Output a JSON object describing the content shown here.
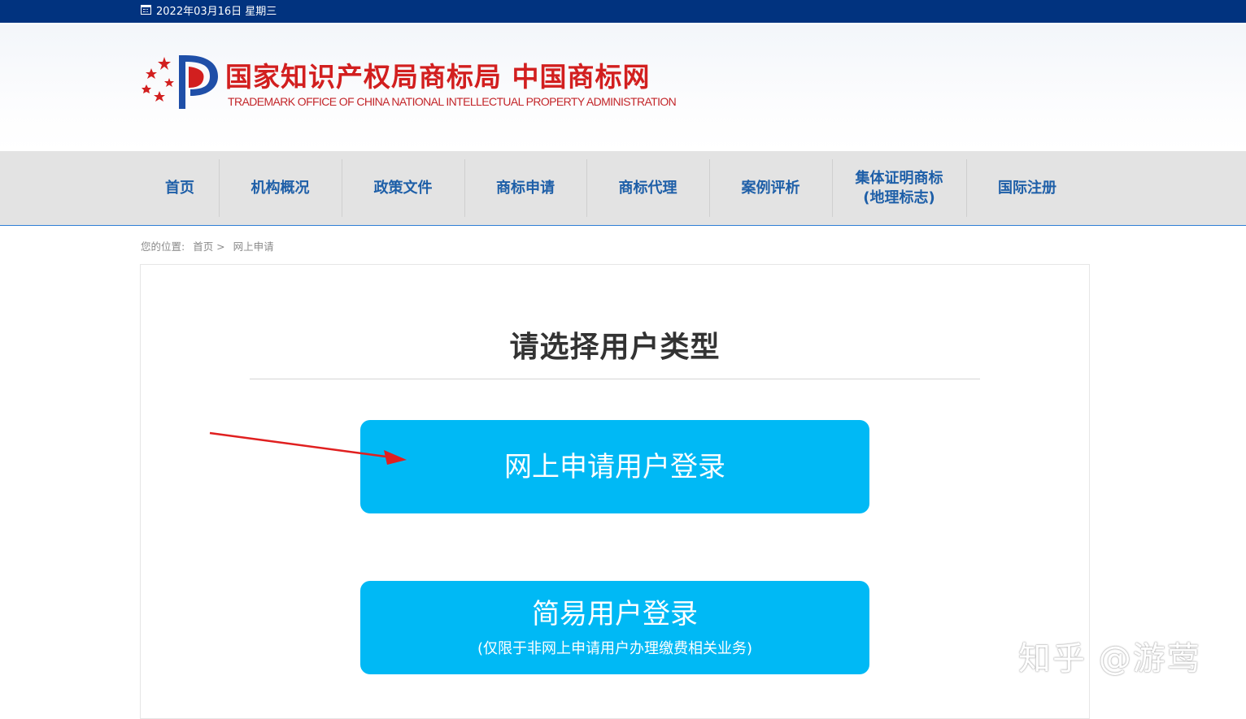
{
  "topbar": {
    "date": "2022年03月16日 星期三",
    "icon": "calendar-icon"
  },
  "header": {
    "title_cn": "国家知识产权局商标局 中国商标网",
    "title_en": "TRADEMARK OFFICE OF CHINA NATIONAL INTELLECTUAL PROPERTY ADMINISTRATION",
    "logo_colors": {
      "red": "#d21f1f",
      "blue": "#1f4fa8"
    }
  },
  "nav": {
    "items": [
      {
        "label": "首页"
      },
      {
        "label": "机构概况"
      },
      {
        "label": "政策文件"
      },
      {
        "label": "商标申请"
      },
      {
        "label": "商标代理"
      },
      {
        "label": "案例评析"
      },
      {
        "label": "集体证明商标",
        "label2": "(地理标志)"
      },
      {
        "label": "国际注册"
      }
    ]
  },
  "breadcrumb": {
    "prefix": "您的位置:",
    "home": "首页 >",
    "current": "网上申请"
  },
  "main": {
    "title": "请选择用户类型",
    "buttons": [
      {
        "label": "网上申请用户登录"
      },
      {
        "label": "简易用户登录",
        "sublabel": "(仅限于非网上申请用户办理缴费相关业务)"
      }
    ]
  },
  "annotation": {
    "arrow_color": "#e02020"
  },
  "watermark": {
    "text": "知乎 @游莺"
  },
  "colors": {
    "topbar": "#01337f",
    "nav_bg": "#e3e3e3",
    "nav_text": "#1e5fa8",
    "button": "#00b9f5"
  }
}
